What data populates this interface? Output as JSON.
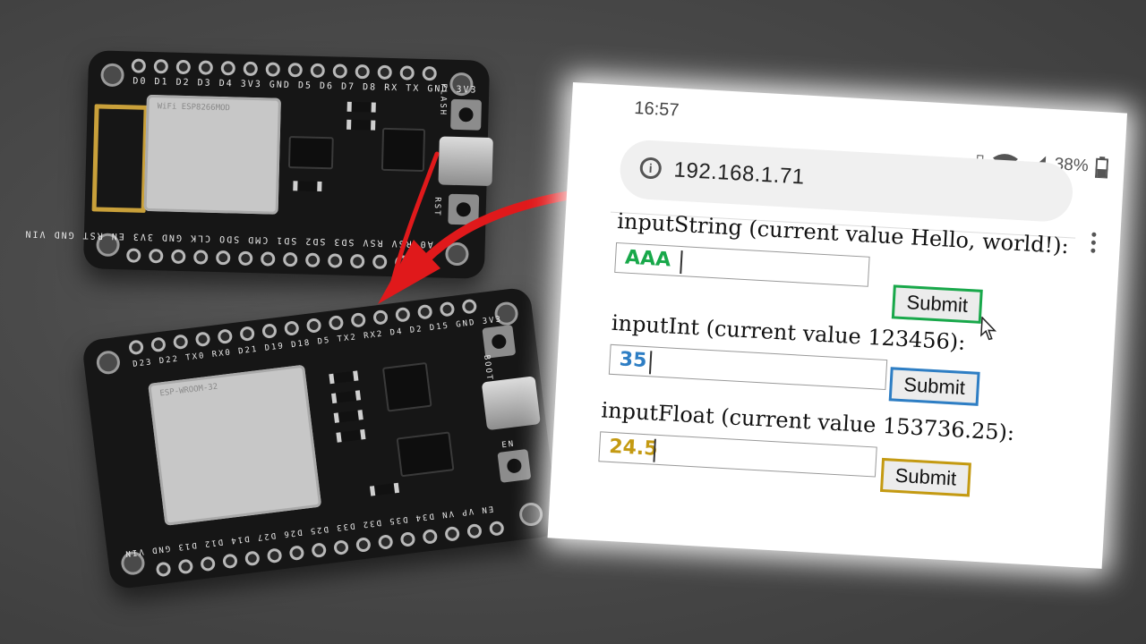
{
  "colors": {
    "green": "#18a84a",
    "blue": "#2e7ec4",
    "gold": "#c49a12",
    "arrow_red": "#e0191b"
  },
  "boards": {
    "esp8266": {
      "top_pins": [
        "D0",
        "D1",
        "D2",
        "D3",
        "D4",
        "3V3",
        "GND",
        "D5",
        "D6",
        "D7",
        "D8",
        "RX",
        "TX",
        "GND",
        "3V3"
      ],
      "bottom_pins": [
        "A0",
        "RSV",
        "RSV",
        "SD3",
        "SD2",
        "SD1",
        "CMD",
        "SDO",
        "CLK",
        "GND",
        "3V3",
        "EN",
        "RST",
        "GND",
        "VIN"
      ],
      "button_flash": "FLASH",
      "button_rst": "RST",
      "module_label": "WiFi ESP8266MOD"
    },
    "esp32": {
      "top_pins": [
        "D23",
        "D22",
        "TX0",
        "RX0",
        "D21",
        "D19",
        "D18",
        "D5",
        "TX2",
        "RX2",
        "D4",
        "D2",
        "D15",
        "GND",
        "3V3"
      ],
      "bottom_pins": [
        "EN",
        "VP",
        "VN",
        "D34",
        "D35",
        "D32",
        "D33",
        "D25",
        "D26",
        "D27",
        "D14",
        "D12",
        "D13",
        "GND",
        "VIN"
      ],
      "button_boot": "BOOT",
      "button_en": "EN",
      "module_label": "ESP-WROOM-32"
    }
  },
  "phone": {
    "time": "16:57",
    "battery": "38%",
    "url": "192.168.1.71",
    "forms": [
      {
        "label": "inputString (current value Hello, world!):",
        "value": "AAA",
        "submit": "Submit",
        "color": "#18a84a"
      },
      {
        "label": "inputInt (current value 123456):",
        "value": "35",
        "submit": "Submit",
        "color": "#2e7ec4"
      },
      {
        "label": "inputFloat (current value 153736.25):",
        "value": "24.5",
        "submit": "Submit",
        "color": "#c49a12"
      }
    ]
  }
}
